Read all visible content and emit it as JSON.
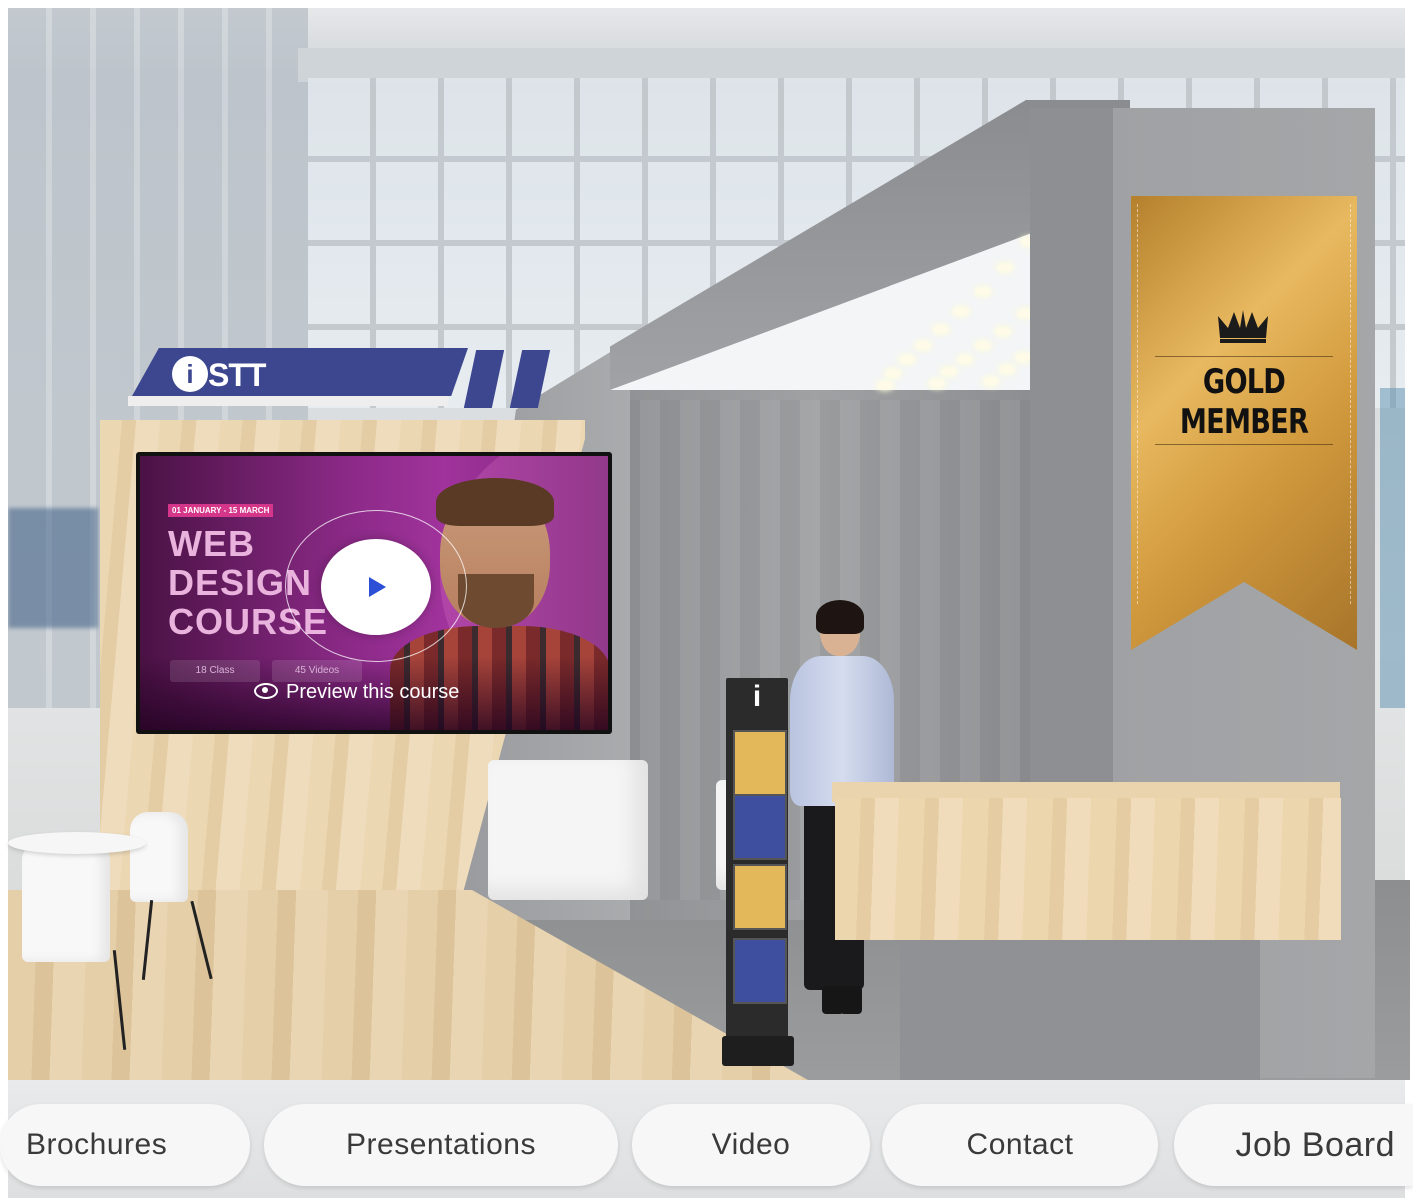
{
  "booth": {
    "logo_mark": "i",
    "logo_text": "STT",
    "badge_line1": "GOLD",
    "badge_line2": "MEMBER",
    "stand_label": "i"
  },
  "video_panel": {
    "date_label": "01 JANUARY - 15 MARCH",
    "title_line1": "WEB",
    "title_line2": "DESIGN",
    "title_line3": "COURSE",
    "chip_1": "18 Class",
    "chip_2": "45 Videos",
    "preview_label": "Preview this course"
  },
  "nav": {
    "items": [
      {
        "label": "Brochures"
      },
      {
        "label": "Presentations"
      },
      {
        "label": "Video"
      },
      {
        "label": "Contact"
      },
      {
        "label": "Job Board"
      }
    ]
  },
  "colors": {
    "brand_navy": "#3c4790",
    "gold": "#d39b3e",
    "play_accent": "#2c4fd6"
  },
  "icons": [
    "play-icon",
    "eye-icon",
    "crown-icon",
    "info-icon"
  ]
}
